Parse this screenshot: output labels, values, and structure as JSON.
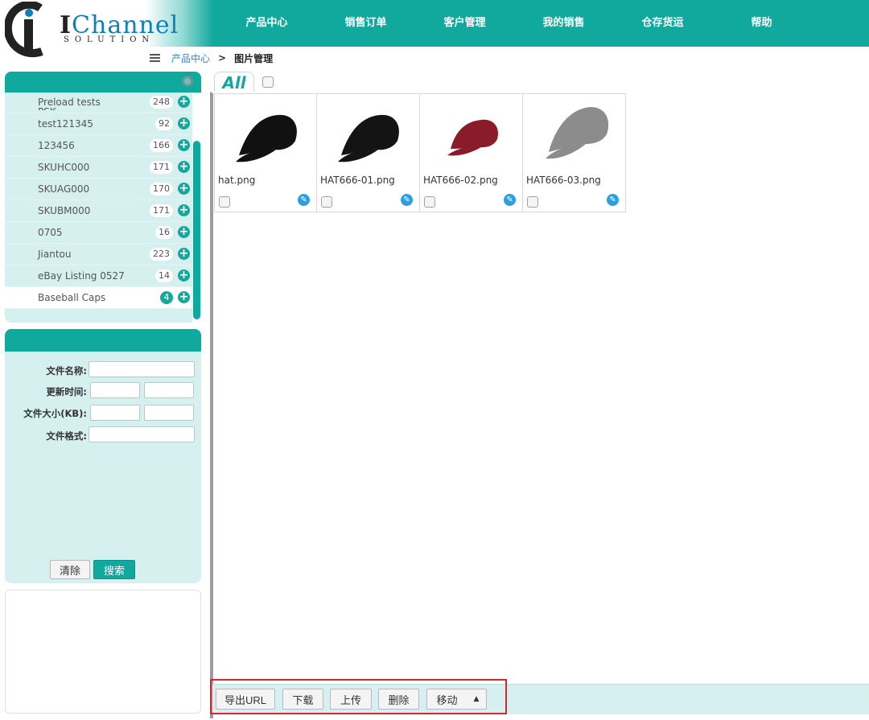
{
  "logo": {
    "brand_first": "I",
    "brand_rest": "Channel",
    "tagline": "SOLUTION"
  },
  "nav": [
    "产品中心",
    "销售订单",
    "客户管理",
    "我的销售",
    "仓存货运",
    "帮助"
  ],
  "breadcrumb": {
    "parent": "产品中心",
    "separator": ">",
    "current": "图片管理"
  },
  "categories": {
    "partial_top": "PSK",
    "items": [
      {
        "name": "Preload tests",
        "count": "248"
      },
      {
        "name": "test121345",
        "count": "92"
      },
      {
        "name": "123456",
        "count": "166"
      },
      {
        "name": "SKUHC000",
        "count": "171"
      },
      {
        "name": "SKUAG000",
        "count": "170"
      },
      {
        "name": "SKUBM000",
        "count": "171"
      },
      {
        "name": "0705",
        "count": "16"
      },
      {
        "name": "Jiantou",
        "count": "223"
      },
      {
        "name": "eBay Listing 0527",
        "count": "14"
      },
      {
        "name": "Baseball Caps",
        "count": "4",
        "selected": true
      }
    ],
    "add_glyph": "+"
  },
  "filter": {
    "file_name_label": "文件名称:",
    "update_time_label": "更新时间:",
    "file_size_label": "文件大小(KB):",
    "file_format_label": "文件格式:",
    "clear_label": "清除",
    "search_label": "搜索"
  },
  "gallery": {
    "tab_label": "All",
    "images": [
      {
        "file": "hat.png",
        "color": "#111111"
      },
      {
        "file": "HAT666-01.png",
        "color": "#141414"
      },
      {
        "file": "HAT666-02.png",
        "color": "#8a1c2a"
      },
      {
        "file": "HAT666-03.png",
        "color": "#8c8c8c"
      }
    ],
    "edit_glyph": "✎"
  },
  "toolbar": {
    "export_url": "导出URL",
    "download": "下载",
    "upload": "上传",
    "delete": "删除",
    "move": "移动",
    "caret": "▲"
  },
  "colors": {
    "accent": "#11a89e",
    "panel_bg": "#d6f0f0",
    "highlight": "#d9262a",
    "link": "#2a8fbd"
  }
}
